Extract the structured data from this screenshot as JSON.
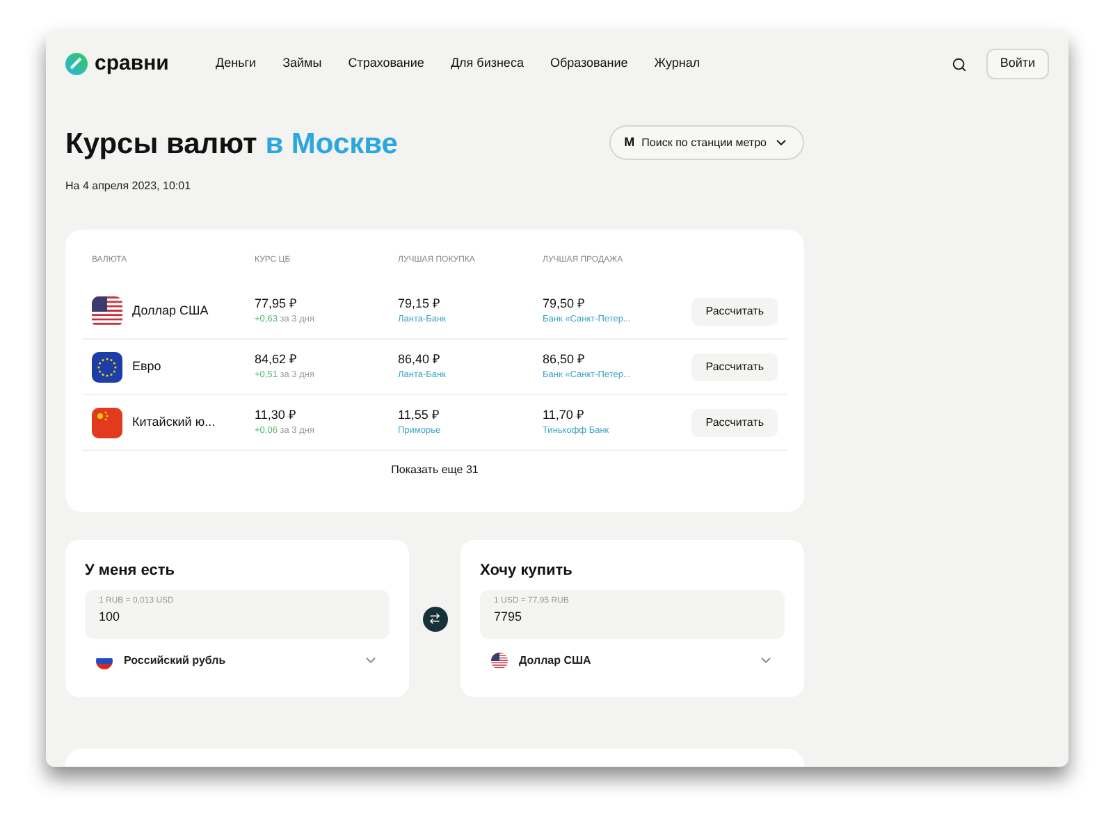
{
  "header": {
    "logo": "сравни",
    "nav": [
      "Деньги",
      "Займы",
      "Страхование",
      "Для бизнеса",
      "Образование",
      "Журнал"
    ],
    "login": "Войти"
  },
  "title": {
    "main": "Курсы валют",
    "accent": "в Москве"
  },
  "date": "На 4 апреля 2023, 10:01",
  "metro": {
    "letter": "М",
    "label": "Поиск по станции метро"
  },
  "table": {
    "columns": [
      "ВАЛЮТА",
      "КУРС ЦБ",
      "ЛУЧШАЯ ПОКУПКА",
      "ЛУЧШАЯ ПРОДАЖА"
    ],
    "rows": [
      {
        "kind": "us",
        "name": "Доллар США",
        "cb": "77,95 ₽",
        "change": "+0,63",
        "period": "за 3 дня",
        "buy": "79,15 ₽",
        "buy_bank": "Ланта-Банк",
        "sell": "79,50 ₽",
        "sell_bank": "Банк «Санкт-Петер...",
        "action": "Рассчитать"
      },
      {
        "kind": "eu",
        "name": "Евро",
        "cb": "84,62 ₽",
        "change": "+0,51",
        "period": "за 3 дня",
        "buy": "86,40 ₽",
        "buy_bank": "Ланта-Банк",
        "sell": "86,50 ₽",
        "sell_bank": "Банк «Санкт-Петер...",
        "action": "Рассчитать"
      },
      {
        "kind": "cn",
        "name": "Китайский ю...",
        "cb": "11,30 ₽",
        "change": "+0,06",
        "period": "за 3 дня",
        "buy": "11,55 ₽",
        "buy_bank": "Приморье",
        "sell": "11,70 ₽",
        "sell_bank": "Тинькофф Банк",
        "action": "Рассчитать"
      }
    ],
    "more": "Показать еще 31"
  },
  "converter": [
    {
      "title": "У меня есть",
      "hint": "1 RUB = 0,013 USD",
      "value": "100",
      "kind": "ru",
      "currency": "Российский рубль"
    },
    {
      "title": "Хочу купить",
      "hint": "1 USD = 77,95 RUB",
      "value": "7795",
      "kind": "us",
      "currency": "Доллар США"
    }
  ]
}
